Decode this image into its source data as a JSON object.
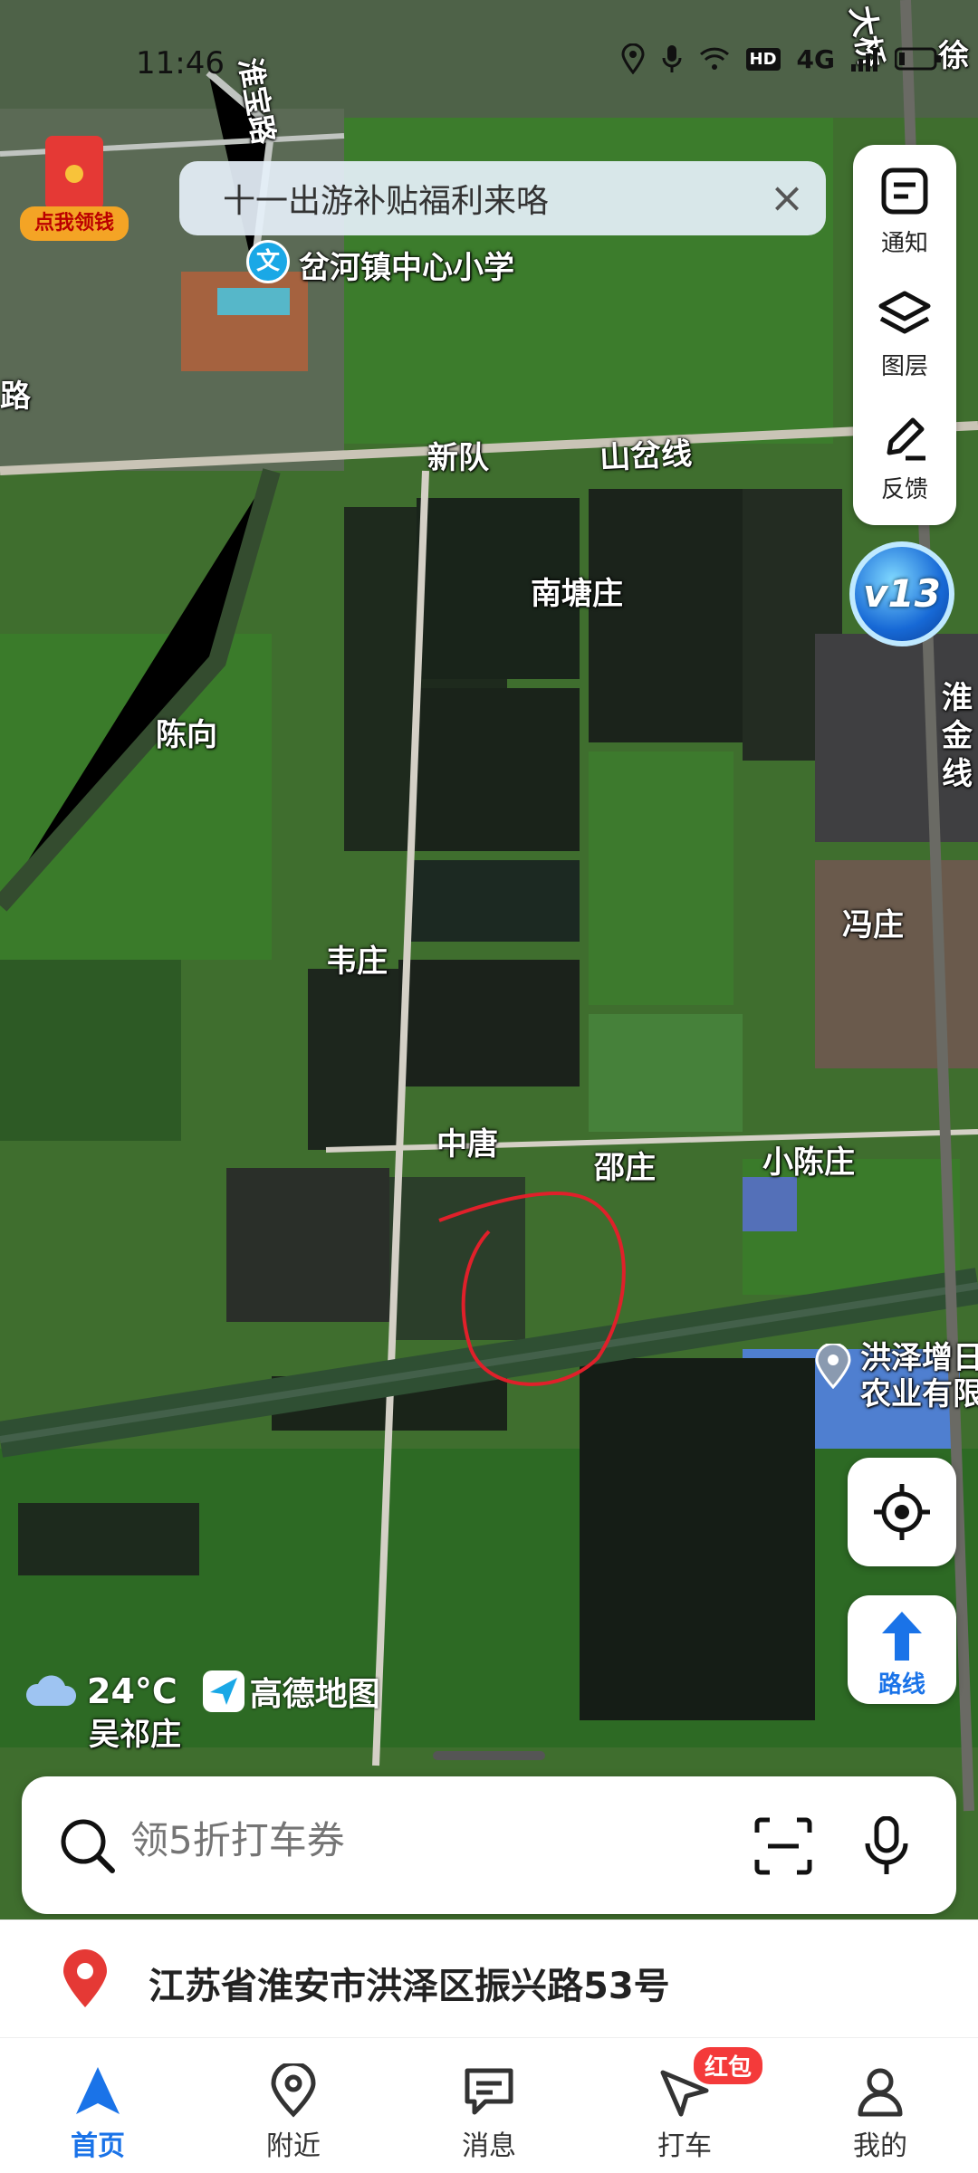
{
  "status_bar": {
    "time": "11:46",
    "network_hd": "HD",
    "network_gen": "4G"
  },
  "promo_banner": {
    "text": "十一出游补贴福利来咯"
  },
  "red_packet": {
    "label": "点我领钱"
  },
  "tool_panel": {
    "notice_label": "通知",
    "layers_label": "图层",
    "feedback_label": "反馈"
  },
  "version_badge": {
    "text": "v13"
  },
  "map_labels": {
    "school": "岔河镇中心小学",
    "road_huaibao": "淮宝路",
    "road_lu": "路",
    "xindui": "新队",
    "shancha_line": "山岔线",
    "nantangzhuang": "南塘庄",
    "chenxiang": "陈向",
    "weizhuang": "韦庄",
    "fengzhuang": "冯庄",
    "zhongtang": "中唐",
    "shaozhuang": "邵庄",
    "xiaochenzhuang": "小陈庄",
    "wuqizhuang": "吴祁庄",
    "daqiao": "大桥",
    "xu": "徐",
    "huaijin_line": "淮金线",
    "company_line1": "洪泽增日",
    "company_line2": "农业有限"
  },
  "route_button": {
    "label": "路线"
  },
  "weather": {
    "temperature": "24°C",
    "provider": "高德地图"
  },
  "search": {
    "placeholder": "领5折打车券"
  },
  "current_address": "江苏省淮安市洪泽区振兴路53号",
  "tabs": [
    {
      "label": "首页",
      "icon": "navigation-arrow-icon",
      "active": true
    },
    {
      "label": "附近",
      "icon": "location-pin-icon",
      "active": false
    },
    {
      "label": "消息",
      "icon": "message-icon",
      "active": false
    },
    {
      "label": "打车",
      "icon": "taxi-icon",
      "active": false,
      "badge": "红包"
    },
    {
      "label": "我的",
      "icon": "profile-icon",
      "active": false
    }
  ],
  "colors": {
    "accent": "#1a73e8",
    "badge": "#f43a3a",
    "pin": "#e53935",
    "annotation": "#e0202a"
  }
}
